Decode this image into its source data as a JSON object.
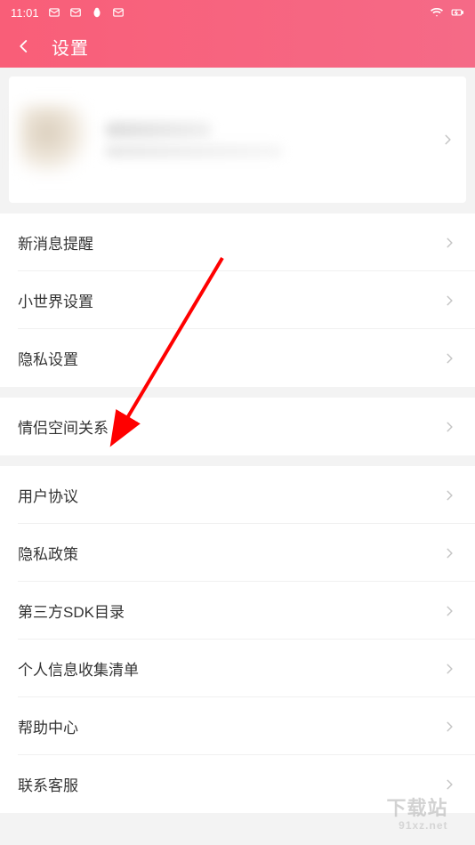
{
  "statusbar": {
    "time": "11:01",
    "icons": [
      "mail-icon",
      "mail-icon",
      "penguin-icon",
      "mail-icon"
    ]
  },
  "header": {
    "title": "设置"
  },
  "sections": {
    "notifications": {
      "new_message": "新消息提醒",
      "mini_world": "小世界设置",
      "privacy": "隐私设置"
    },
    "couple": {
      "relationship": "情侣空间关系"
    },
    "legal": {
      "user_agreement": "用户协议",
      "privacy_policy": "隐私政策",
      "sdk_catalog": "第三方SDK目录",
      "data_collection": "个人信息收集清单",
      "help_center": "帮助中心",
      "contact": "联系客服"
    }
  },
  "watermark": {
    "main": "下载站",
    "sub": "91xz.net"
  }
}
